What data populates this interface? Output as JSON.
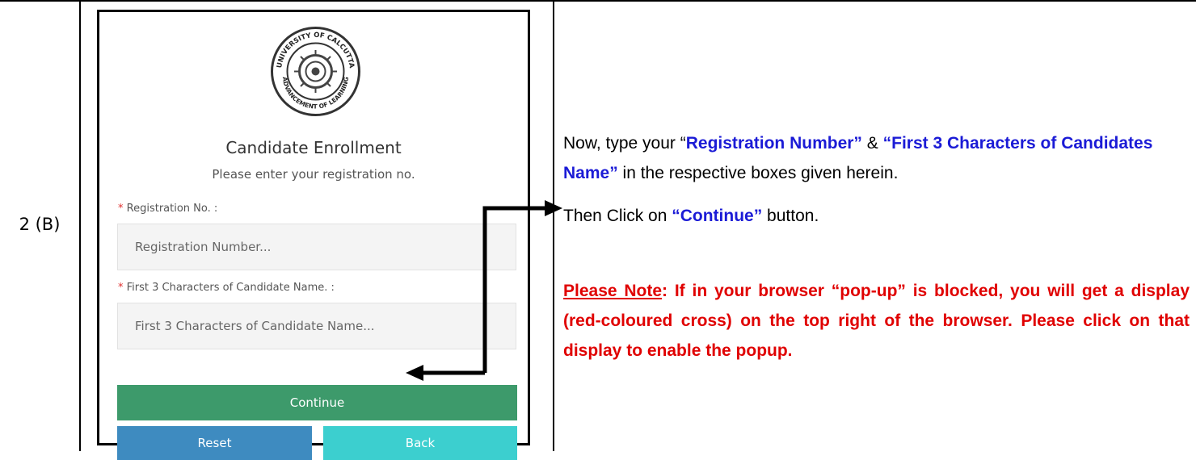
{
  "row_label": "2 (B)",
  "form": {
    "title": "Candidate Enrollment",
    "subtitle": "Please enter your registration no.",
    "seal_text": "UNIVERSITY OF CALCUTTA · ADVANCEMENT OF LEARNING",
    "field1": {
      "required_mark": "*",
      "label": "Registration No. :",
      "placeholder": "Registration Number..."
    },
    "field2": {
      "required_mark": "*",
      "label": "First 3 Characters of Candidate Name. :",
      "placeholder": "First 3 Characters of Candidate Name..."
    },
    "continue_label": "Continue",
    "reset_label": "Reset",
    "back_label": "Back"
  },
  "instructions": {
    "p1": {
      "a": "Now, type your ",
      "q1": "“",
      "b": "Registration Number”",
      "c": " & ",
      "d": "“First 3 Characters of Candidates Name”",
      "e": " in the respective boxes given herein."
    },
    "p2": {
      "a": "Then Click on ",
      "b": "“Continue”",
      "c": " button."
    },
    "note": {
      "label": "Please Note",
      "text": ": If in your browser “pop-up” is blocked, you will get a display (red-coloured cross) on the top right of the browser. Please click on that display to enable the popup."
    }
  },
  "colors": {
    "continue": "#3d9a6b",
    "reset": "#3e8bc0",
    "back": "#3ccfcf",
    "highlight_blue": "#1b1bd6",
    "note_red": "#e00000"
  }
}
